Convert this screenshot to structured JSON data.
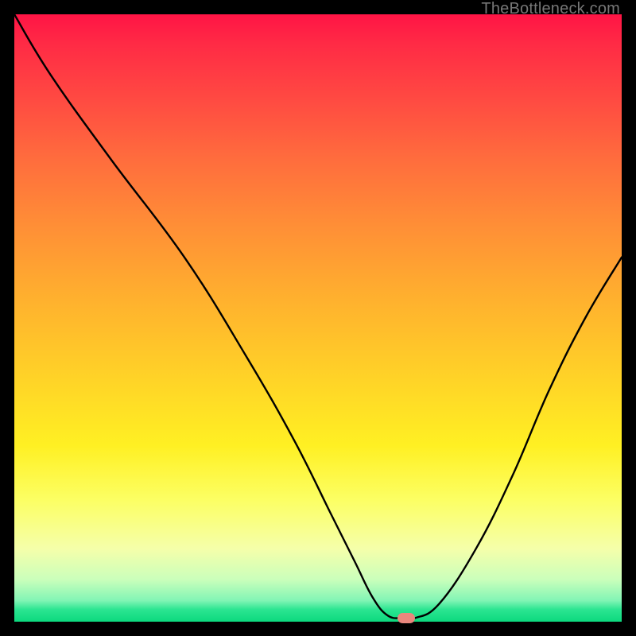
{
  "watermark": "TheBottleneck.com",
  "chart_data": {
    "type": "line",
    "title": "",
    "xlabel": "",
    "ylabel": "",
    "xlim": [
      0,
      100
    ],
    "ylim": [
      0,
      100
    ],
    "x": [
      0,
      6,
      16,
      28,
      38,
      46,
      52,
      56,
      59,
      61.5,
      64,
      66,
      70,
      76,
      82,
      88,
      94,
      100
    ],
    "values": [
      100,
      90,
      76,
      60,
      44,
      30,
      18,
      10,
      4,
      1,
      0.6,
      0.6,
      3,
      12,
      24,
      38,
      50,
      60
    ],
    "marker": {
      "x": 64.5,
      "y": 0.6
    },
    "gradient_stops": [
      {
        "pos": 0,
        "color": "#ff1445"
      },
      {
        "pos": 50,
        "color": "#ffc22a"
      },
      {
        "pos": 80,
        "color": "#fcff64"
      },
      {
        "pos": 100,
        "color": "#0cd97e"
      }
    ]
  }
}
